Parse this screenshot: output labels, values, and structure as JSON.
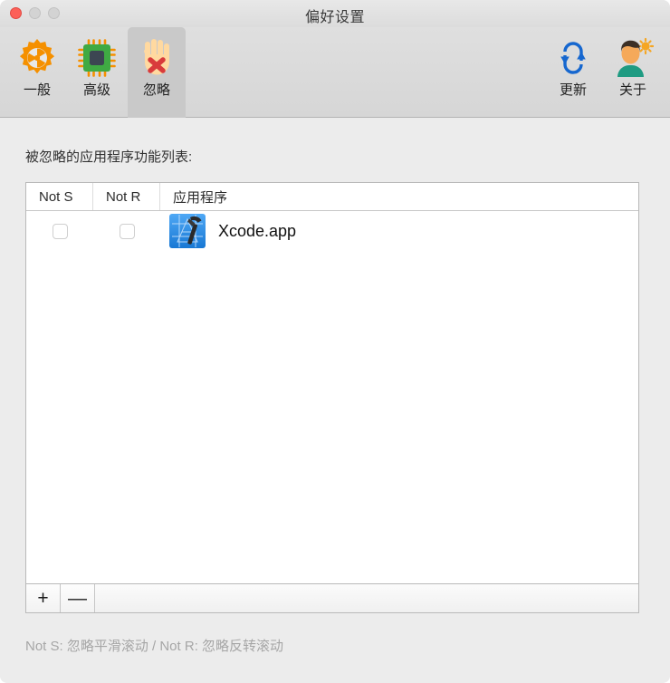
{
  "window": {
    "title": "偏好设置",
    "traffic_lights": {
      "close_color": "#fc6058",
      "minimize_color": "#d3d3d3",
      "maximize_color": "#d3d3d3"
    }
  },
  "toolbar": {
    "left_items": [
      {
        "label": "一般",
        "icon": "gear-icon",
        "selected": false
      },
      {
        "label": "高级",
        "icon": "cpu-chip-icon",
        "selected": false
      },
      {
        "label": "忽略",
        "icon": "raised-hand-x-icon",
        "selected": true
      }
    ],
    "right_items": [
      {
        "label": "更新",
        "icon": "refresh-cycle-icon",
        "selected": false
      },
      {
        "label": "关于",
        "icon": "person-sun-icon",
        "selected": false
      }
    ]
  },
  "main": {
    "section_label": "被忽略的应用程序功能列表:",
    "table": {
      "columns": [
        "Not S",
        "Not R",
        "应用程序"
      ],
      "rows": [
        {
          "not_s_checked": false,
          "not_r_checked": false,
          "app_icon": "xcode-app-icon",
          "app_name": "Xcode.app"
        }
      ]
    },
    "table_footer": {
      "add_label": "+",
      "remove_label": "—"
    },
    "footnote": "Not S: 忽略平滑滚动 / Not R: 忽略反转滚动"
  }
}
